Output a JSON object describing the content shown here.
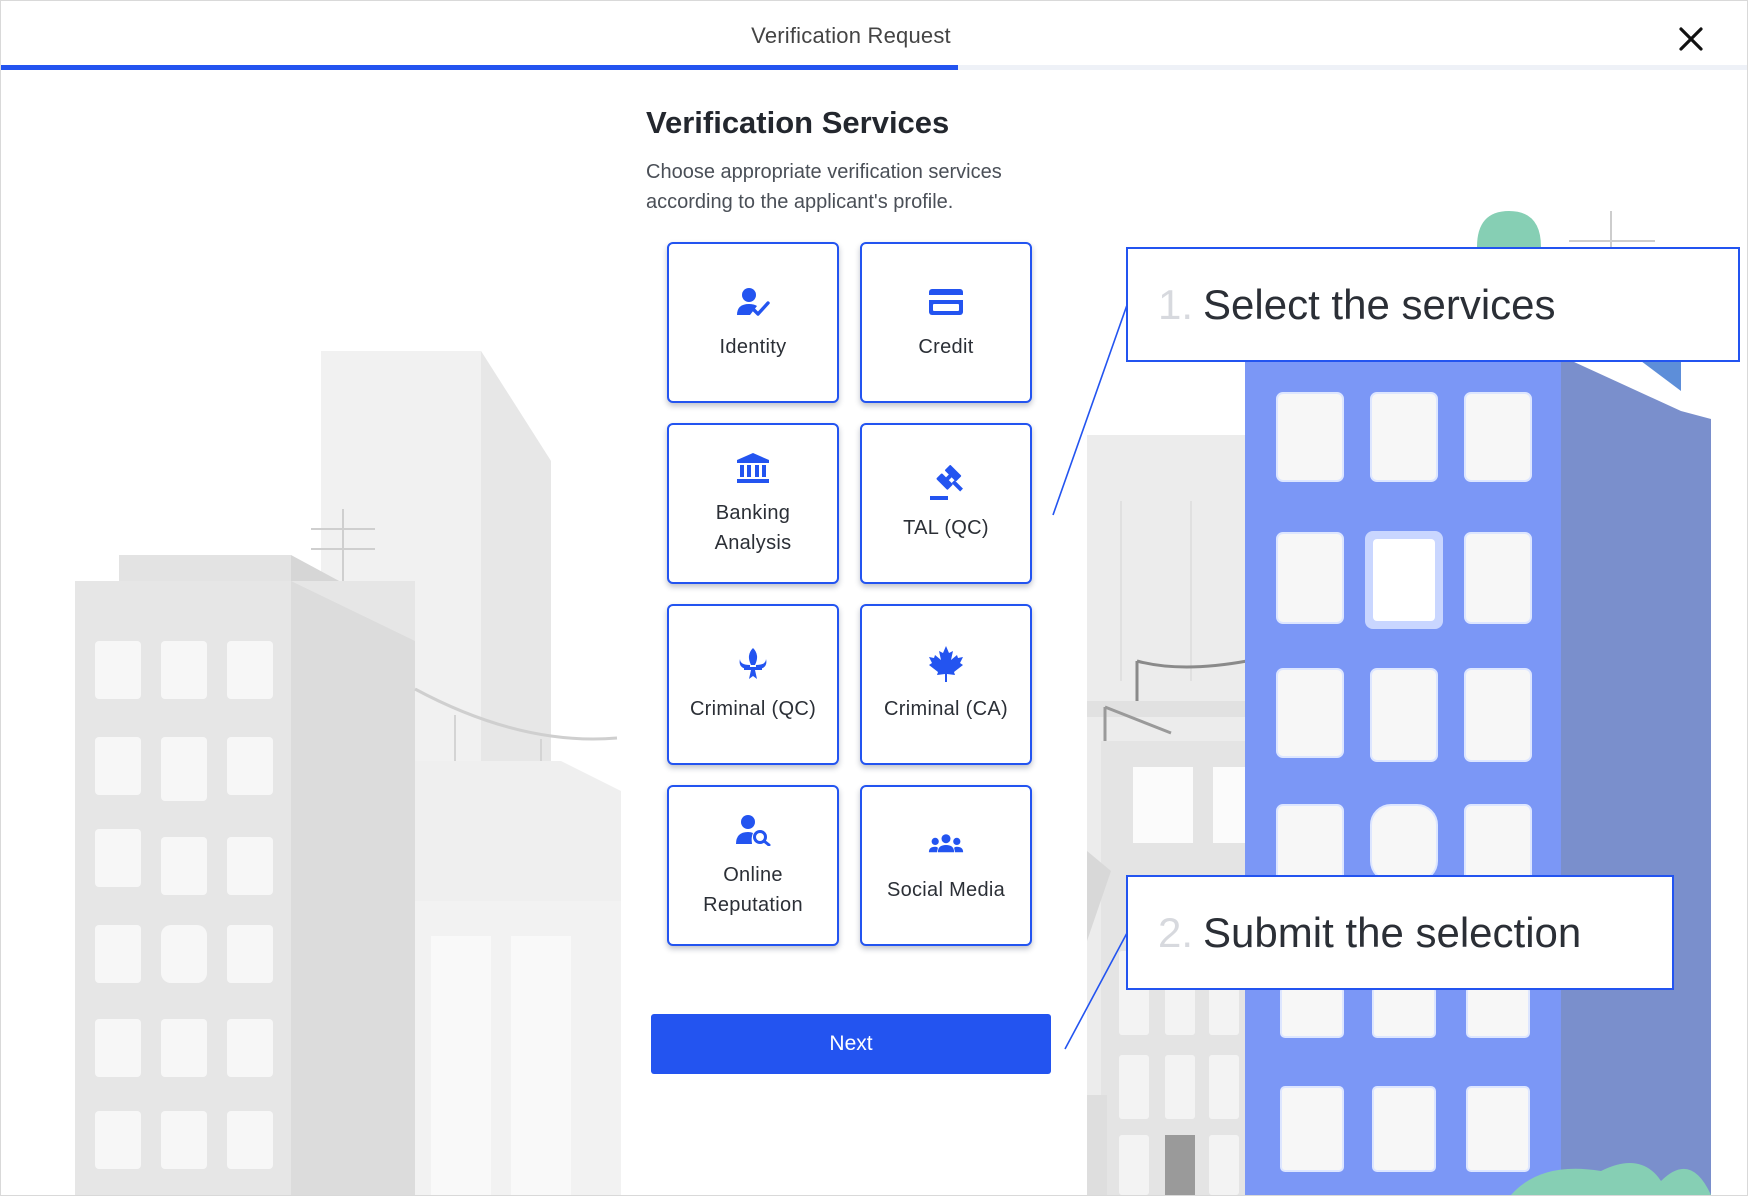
{
  "header": {
    "title": "Verification Request",
    "progress_fraction": 0.548
  },
  "page": {
    "title": "Verification Services",
    "subtitle": "Choose appropriate verification services according to the applicant's profile."
  },
  "services": [
    {
      "label_lines": [
        "Identity"
      ],
      "icon": "user-check-icon"
    },
    {
      "label_lines": [
        "Credit"
      ],
      "icon": "credit-card-icon"
    },
    {
      "label_lines": [
        "Banking",
        "Analysis"
      ],
      "icon": "bank-icon"
    },
    {
      "label_lines": [
        "TAL (QC)"
      ],
      "icon": "gavel-icon"
    },
    {
      "label_lines": [
        "Criminal (QC)"
      ],
      "icon": "fleur-de-lis-icon"
    },
    {
      "label_lines": [
        "Criminal (CA)"
      ],
      "icon": "maple-leaf-icon"
    },
    {
      "label_lines": [
        "Online",
        "Reputation"
      ],
      "icon": "user-search-icon"
    },
    {
      "label_lines": [
        "Social Media"
      ],
      "icon": "users-group-icon"
    }
  ],
  "next_button": {
    "label": "Next"
  },
  "callouts": [
    {
      "number": "1.",
      "text": "Select the services"
    },
    {
      "number": "2.",
      "text": "Submit the selection"
    }
  ],
  "colors": {
    "accent": "#2354f0",
    "building_blue": "#7b97f6",
    "building_shadow": "#7a8fcc",
    "green": "#86cfb4"
  }
}
